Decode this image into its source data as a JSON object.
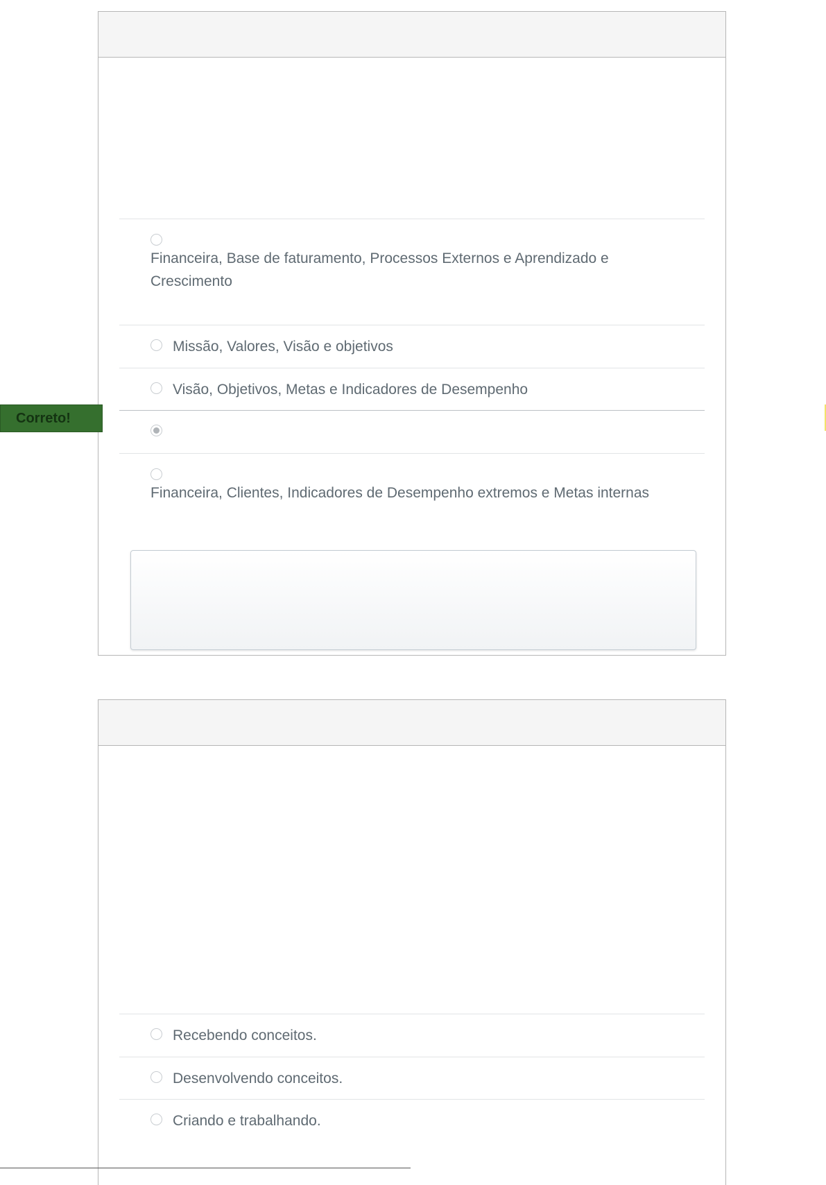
{
  "questions": [
    {
      "answers": [
        {
          "text": "Financeira, Base de faturamento, Processos Externos e Aprendizado e Crescimento",
          "selected": false
        },
        {
          "text": "Missão, Valores, Visão e objetivos",
          "selected": false
        },
        {
          "text": "Visão, Objetivos, Metas e Indicadores de Desempenho",
          "selected": false
        },
        {
          "text": "",
          "selected": true
        },
        {
          "text": "Financeira, Clientes, Indicadores de Desempenho extremos e Metas internas",
          "selected": false
        }
      ],
      "feedback_label": "Correto!"
    },
    {
      "answers": [
        {
          "text": "Recebendo conceitos.",
          "selected": false
        },
        {
          "text": "Desenvolvendo conceitos.",
          "selected": false
        },
        {
          "text": "Criando e trabalhando.",
          "selected": false
        }
      ]
    }
  ],
  "colors": {
    "correct_flag_bg": "#356f2e",
    "correct_flag_text": "#143312",
    "answer_text": "#5f6a72",
    "card_border": "#b6b6b6",
    "header_bg": "#f5f5f5"
  },
  "icons": {
    "radio": "radio-button-icon",
    "radio_selected": "radio-button-selected-icon"
  }
}
